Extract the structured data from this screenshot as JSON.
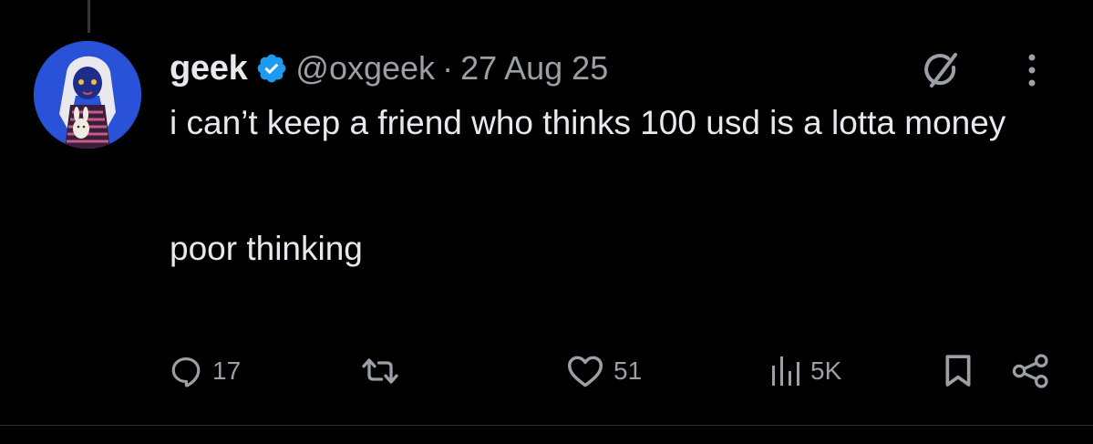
{
  "tweet": {
    "author": {
      "display_name": "geek",
      "handle": "@oxgeek",
      "verified": true,
      "avatar": "anime-character-avatar"
    },
    "separator": "·",
    "date": "27 Aug 25",
    "text_lines": [
      "i can’t keep a friend who thinks 100 usd is a lotta money",
      "poor thinking"
    ],
    "header_icons": [
      "grok-icon",
      "more-options-icon"
    ]
  },
  "actions": {
    "replies": {
      "icon": "reply-icon",
      "count": "17"
    },
    "reposts": {
      "icon": "repost-icon",
      "count": ""
    },
    "likes": {
      "icon": "heart-icon",
      "count": "51"
    },
    "views": {
      "icon": "views-icon",
      "count": "5K"
    },
    "bookmark": {
      "icon": "bookmark-icon"
    },
    "share": {
      "icon": "share-icon"
    }
  },
  "colors": {
    "background": "#000000",
    "primary_text": "#e7e9ea",
    "secondary_text": "#9aa0a6",
    "verified_blue": "#1d9bf0"
  }
}
